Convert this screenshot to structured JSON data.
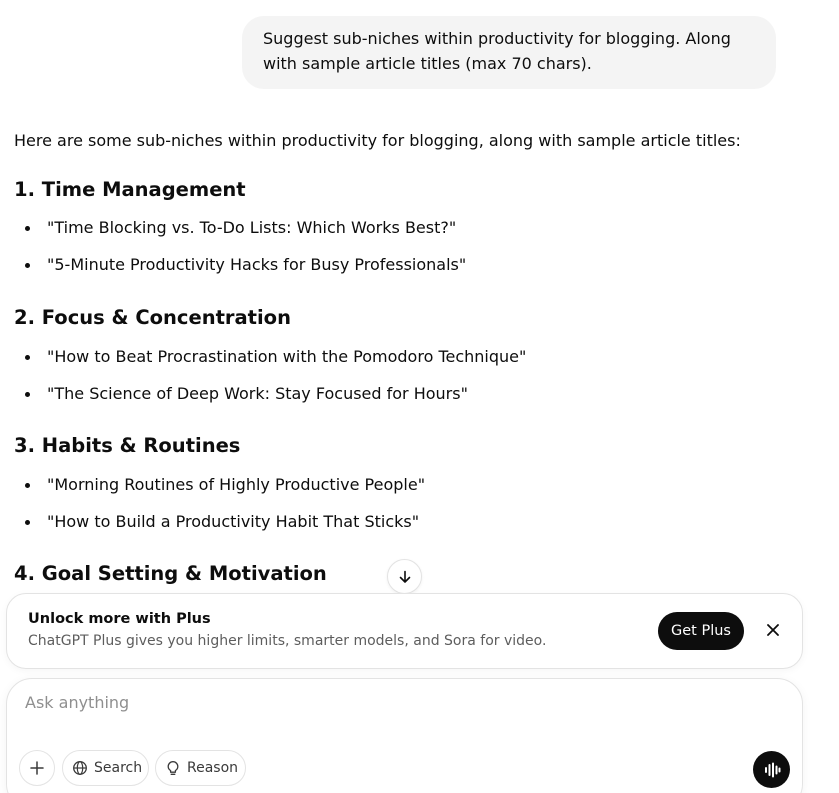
{
  "user_message": "Suggest sub-niches within productivity for blogging. Along with sample article titles (max 70 chars).",
  "answer": {
    "intro": "Here are some sub-niches within productivity for blogging, along with sample article titles:",
    "sections": [
      {
        "title": "1. Time Management",
        "items": [
          "\"Time Blocking vs. To-Do Lists: Which Works Best?\"",
          "\"5-Minute Productivity Hacks for Busy Professionals\""
        ]
      },
      {
        "title": "2. Focus & Concentration",
        "items": [
          "\"How to Beat Procrastination with the Pomodoro Technique\"",
          "\"The Science of Deep Work: Stay Focused for Hours\""
        ]
      },
      {
        "title": "3. Habits & Routines",
        "items": [
          "\"Morning Routines of Highly Productive People\"",
          "\"How to Build a Productivity Habit That Sticks\""
        ]
      },
      {
        "title": "4. Goal Setting & Motivation",
        "items": []
      }
    ]
  },
  "upsell": {
    "title": "Unlock more with Plus",
    "description": "ChatGPT Plus gives you higher limits, smarter models, and Sora for video.",
    "cta_label": "Get Plus"
  },
  "composer": {
    "placeholder": "Ask anything",
    "search_label": "Search",
    "reason_label": "Reason"
  },
  "icons": {
    "scroll_down": "arrow-down-icon",
    "close": "close-icon",
    "add": "plus-icon",
    "search": "globe-icon",
    "reason": "lightbulb-icon",
    "voice": "voice-waveform-icon"
  }
}
